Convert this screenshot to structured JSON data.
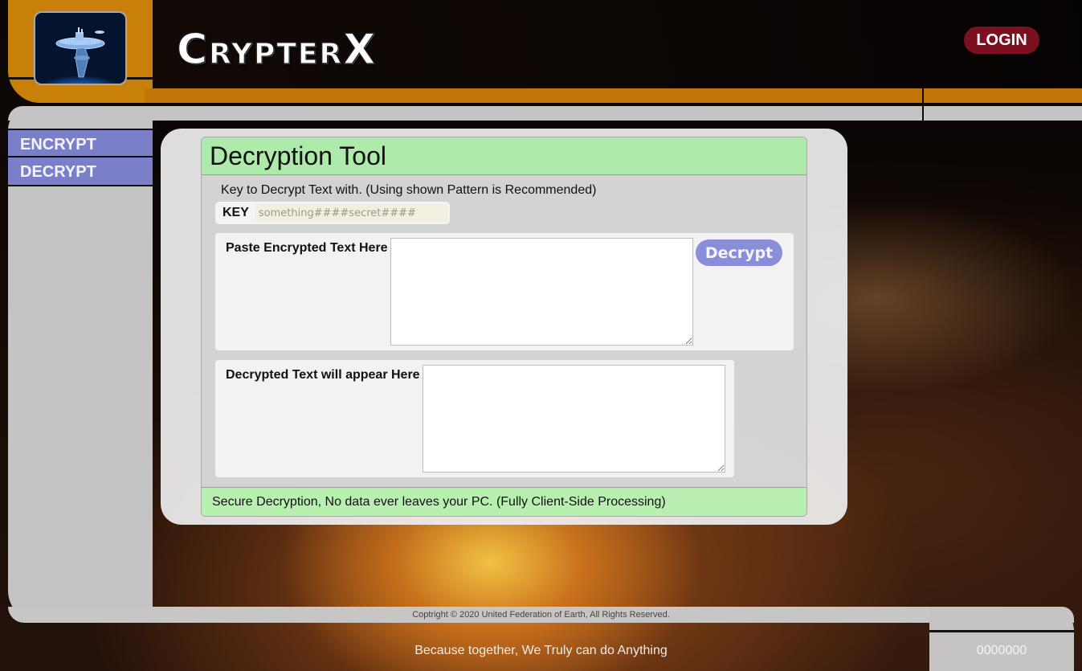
{
  "header": {
    "logo_alt": "space-station-logo",
    "brand_first": "C",
    "brand_rest": "RYPTER",
    "brand_last": "X",
    "login_label": "LOGIN"
  },
  "sidebar": {
    "items": [
      {
        "label": "ENCRYPT"
      },
      {
        "label": "DECRYPT"
      }
    ]
  },
  "tool": {
    "title": "Decryption Tool",
    "key_caption": "Key to Decrypt Text with. (Using shown Pattern is Recommended)",
    "key_label": "KEY",
    "key_placeholder": "something####secret####",
    "key_value": "",
    "input_label": "Paste Encrypted Text Here",
    "input_value": "",
    "decrypt_label": "Decrypt",
    "output_label": "Decrypted Text will appear Here",
    "output_value": "",
    "footer_note": "Secure Decryption, No data ever leaves your PC. (Fully Client-Side Processing)"
  },
  "footer": {
    "copyright": "Coptright © 2020 United Federation of Earth, All Rights Reserved.",
    "motto": "Because together, We Truly can do Anything",
    "counter": "0000000"
  },
  "colors": {
    "frame_orange": "#c8800a",
    "frame_grey": "#c4c4c4",
    "nav_purple": "#7b7fc9",
    "login_red": "#7d1020",
    "header_green": "#aeeaaa",
    "button_purple": "#8a8ed8"
  }
}
